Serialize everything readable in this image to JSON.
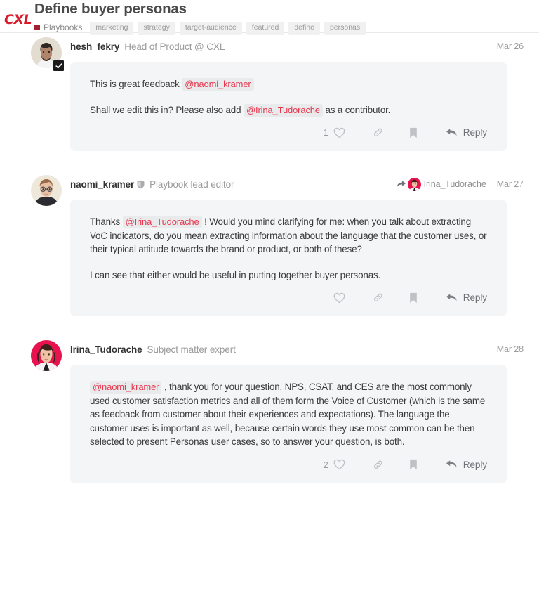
{
  "header": {
    "brand": "CXL",
    "title": "Define buyer personas",
    "category": "Playbooks",
    "tags": [
      "marketing",
      "strategy",
      "target-audience",
      "featured",
      "define",
      "personas"
    ]
  },
  "actions": {
    "reply_label": "Reply",
    "heart_icon": "heart-icon",
    "link_icon": "link-icon",
    "bookmark_icon": "bookmark-icon",
    "reply_icon": "reply-arrow-icon"
  },
  "comments": [
    {
      "author": "hesh_fekry",
      "role": "Head of Product @ CXL",
      "date": "Mar 26",
      "verified": true,
      "shield": false,
      "reply_to": null,
      "like_count": "1",
      "paragraphs": [
        [
          {
            "t": "text",
            "v": "This is great feedback "
          },
          {
            "t": "mention",
            "v": "@naomi_kramer"
          }
        ],
        [
          {
            "t": "text",
            "v": "Shall we edit this in? Please also add "
          },
          {
            "t": "mention",
            "v": "@Irina_Tudorache"
          },
          {
            "t": "text",
            "v": " as a contributor."
          }
        ]
      ]
    },
    {
      "author": "naomi_kramer",
      "role": "Playbook lead editor",
      "date": "Mar 27",
      "verified": false,
      "shield": true,
      "reply_to": "Irina_Tudorache",
      "like_count": "",
      "paragraphs": [
        [
          {
            "t": "text",
            "v": "Thanks "
          },
          {
            "t": "mention",
            "v": "@Irina_Tudorache"
          },
          {
            "t": "text",
            "v": " ! Would you mind clarifying for me: when you talk about extracting VoC indicators, do you mean extracting information about the language that the customer uses, or their typical attitude towards the brand or product, or both of these?"
          }
        ],
        [
          {
            "t": "text",
            "v": "I can see that either would be useful in putting together buyer personas."
          }
        ]
      ]
    },
    {
      "author": "Irina_Tudorache",
      "role": "Subject matter expert",
      "date": "Mar 28",
      "verified": false,
      "shield": false,
      "reply_to": null,
      "like_count": "2",
      "paragraphs": [
        [
          {
            "t": "mention",
            "v": "@naomi_kramer"
          },
          {
            "t": "text",
            "v": " , thank you for your question. NPS, CSAT, and CES are the most commonly used customer satisfaction metrics and all of them form the Voice of Customer (which is the same as feedback from customer about their experiences and expectations). The language the customer uses is important as well, because certain words they use most common can be then selected to present Personas user cases, so to answer your question, is both."
          }
        ]
      ]
    }
  ],
  "colors": {
    "brand_red": "#d91c2b",
    "mention_red": "#e8384f",
    "bubble_bg": "#f4f5f7",
    "category_bullet": "#a32230"
  }
}
